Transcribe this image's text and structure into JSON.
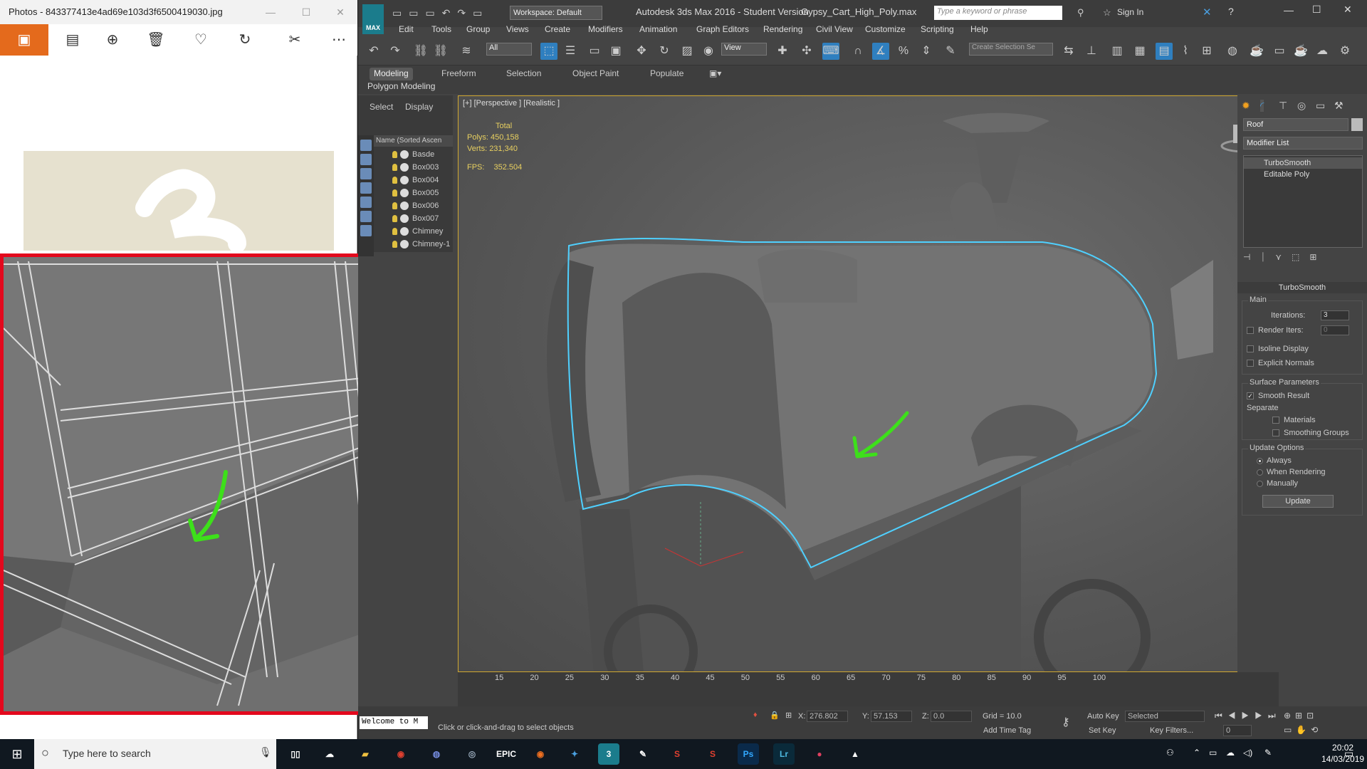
{
  "photos": {
    "title": "Photos - 843377413e4ad69e103d3f6500419030.jpg",
    "toolbar": [
      "home-icon",
      "view-icon",
      "zoom-icon",
      "delete-icon",
      "heart-icon",
      "rotate-icon",
      "edit-icon",
      "more-icon"
    ]
  },
  "max": {
    "logo": "MAX",
    "workspace": "Workspace: Default",
    "title": "Autodesk 3ds Max 2016 - Student Version",
    "file": "Gypsy_Cart_High_Poly.max",
    "search_placeholder": "Type a keyword or phrase",
    "signin": "Sign In",
    "menus": [
      "Edit",
      "Tools",
      "Group",
      "Views",
      "Create",
      "Modifiers",
      "Animation",
      "Graph Editors",
      "Rendering",
      "Civil View",
      "Customize",
      "Scripting",
      "Help"
    ],
    "filter": "All",
    "view": "View",
    "create_selection": "Create Selection Se",
    "ribbon_tabs": [
      "Modeling",
      "Freeform",
      "Selection",
      "Object Paint",
      "Populate"
    ],
    "ribbon_label": "Polygon Modeling"
  },
  "scene": {
    "tabs": [
      "Select",
      "Display"
    ],
    "header": "Name (Sorted Ascen",
    "objects": [
      "Basde",
      "Box003",
      "Box004",
      "Box005",
      "Box006",
      "Box007",
      "Chimney",
      "Chimney-1"
    ]
  },
  "viewport": {
    "label": "[+] [Perspective ] [Realistic ]",
    "total_label": "Total",
    "polys_label": "Polys:",
    "polys": "450,158",
    "verts_label": "Verts:",
    "verts": "231,340",
    "fps_label": "FPS:",
    "fps": "352.504"
  },
  "command": {
    "object_name": "Roof",
    "modifier_list": "Modifier List",
    "stack": [
      "TurboSmooth",
      "Editable Poly"
    ],
    "rollout": "TurboSmooth",
    "main": "Main",
    "iterations_label": "Iterations:",
    "iterations": "3",
    "render_iters_label": "Render Iters:",
    "render_iters": "0",
    "isoline": "Isoline Display",
    "explicit": "Explicit Normals",
    "surface": "Surface Parameters",
    "smooth_result": "Smooth Result",
    "separate": "Separate",
    "materials": "Materials",
    "smoothing_groups": "Smoothing Groups",
    "update_options": "Update Options",
    "always": "Always",
    "when_rendering": "When Rendering",
    "manually": "Manually",
    "update": "Update"
  },
  "timeline": {
    "ticks": [
      "15",
      "20",
      "25",
      "30",
      "35",
      "40",
      "45",
      "50",
      "55",
      "60",
      "65",
      "70",
      "75",
      "80",
      "85",
      "90",
      "95",
      "100"
    ]
  },
  "status": {
    "listener": "Welcome to M",
    "prompt": "Click or click-and-drag to select objects",
    "x_label": "X:",
    "x": "276.802",
    "y_label": "Y:",
    "y": "57.153",
    "z_label": "Z:",
    "z": "0.0",
    "grid": "Grid = 10.0",
    "add_time_tag": "Add Time Tag",
    "auto_key": "Auto Key",
    "selected": "Selected",
    "set_key": "Set Key",
    "key_filters": "Key Filters...",
    "frame": "0"
  },
  "taskbar": {
    "search_placeholder": "Type here to search",
    "time": "20:02",
    "date": "14/03/2019"
  },
  "colors": {
    "selection_outline": "#4fd0ff",
    "arrow": "#3de01a",
    "zoom_border": "#e3081d"
  }
}
